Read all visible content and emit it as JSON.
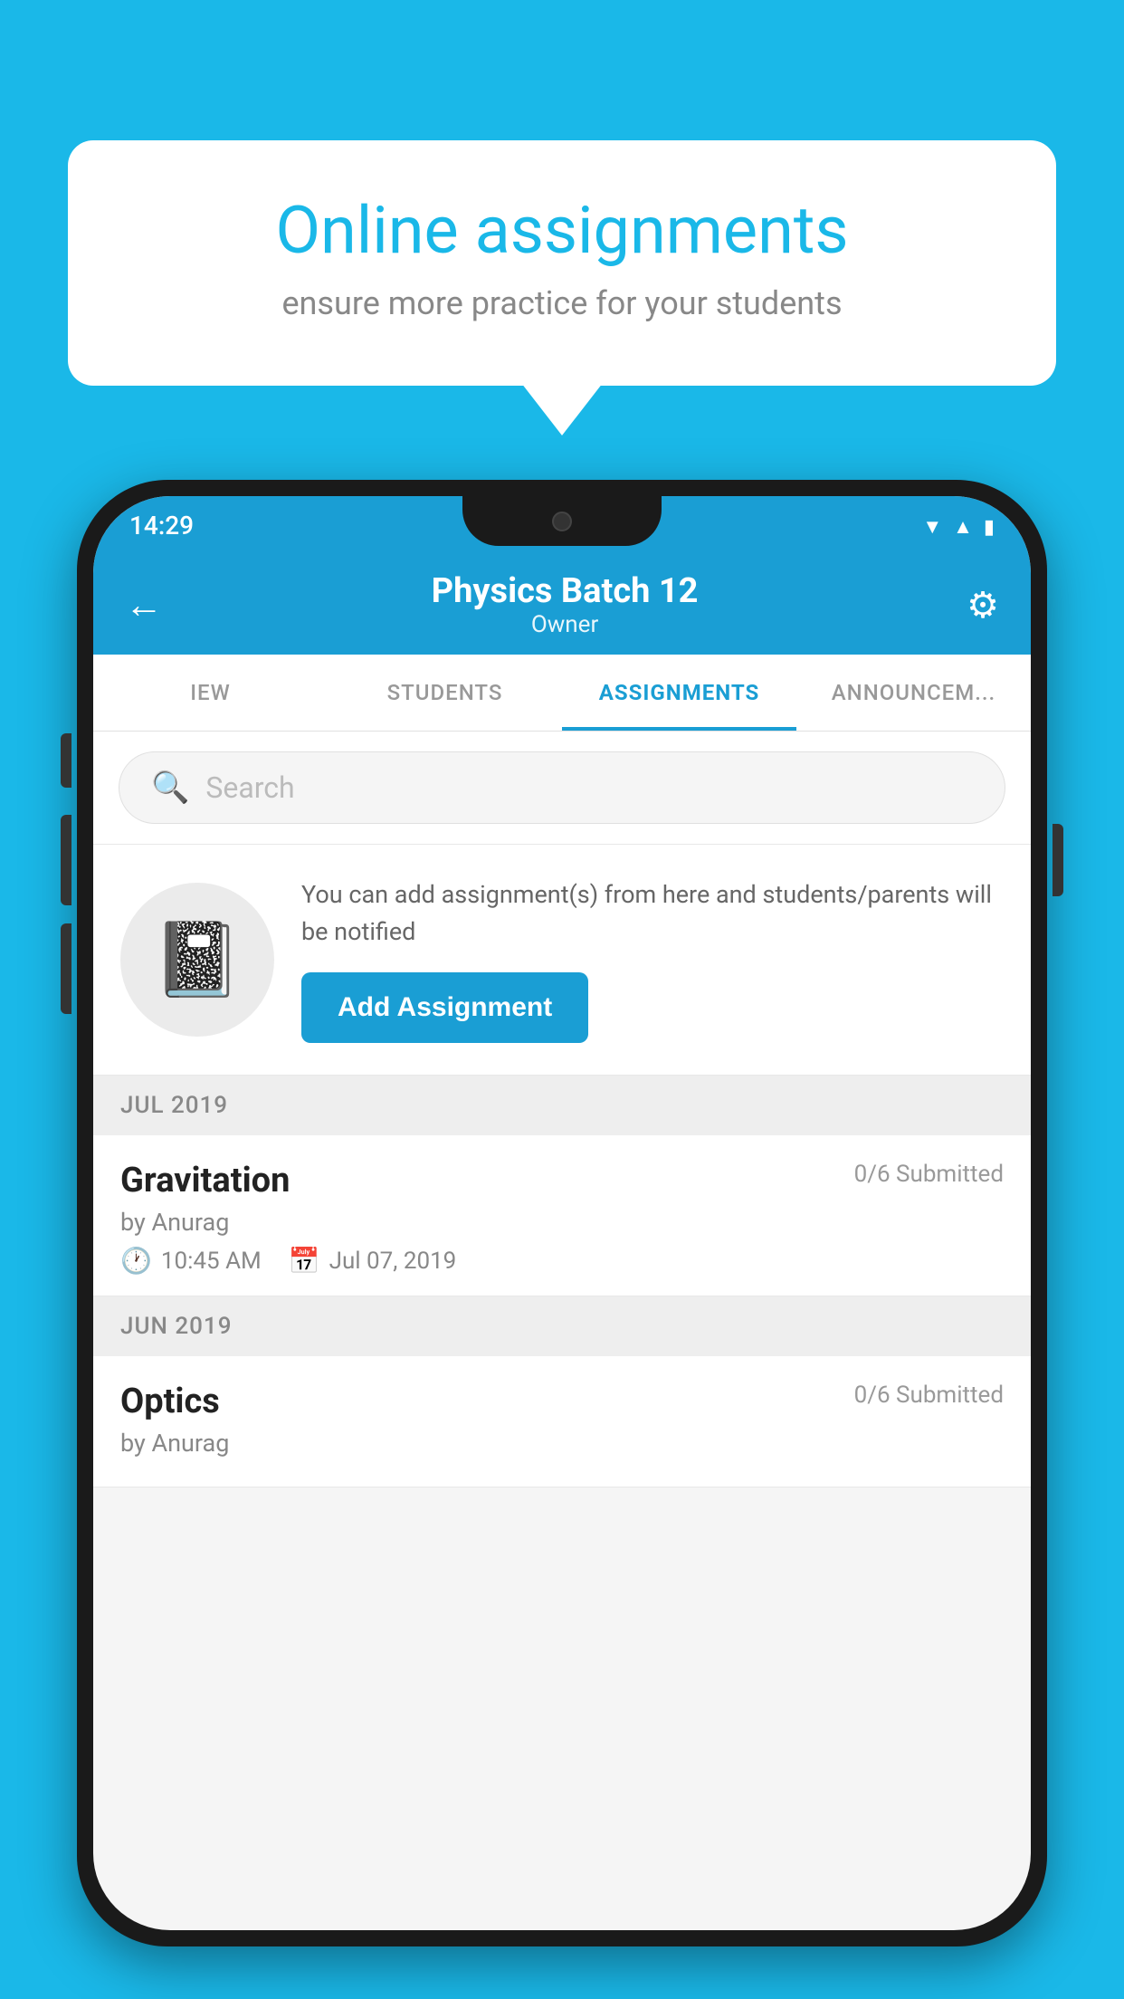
{
  "background_color": "#1ab8e8",
  "speech_bubble": {
    "title": "Online assignments",
    "subtitle": "ensure more practice for your students"
  },
  "phone": {
    "status_bar": {
      "time": "14:29",
      "icons": [
        "wifi",
        "signal",
        "battery"
      ]
    },
    "header": {
      "title": "Physics Batch 12",
      "subtitle": "Owner",
      "back_label": "←",
      "gear_label": "⚙"
    },
    "tabs": [
      {
        "label": "IEW",
        "active": false
      },
      {
        "label": "STUDENTS",
        "active": false
      },
      {
        "label": "ASSIGNMENTS",
        "active": true
      },
      {
        "label": "ANNOUNCEM...",
        "active": false
      }
    ],
    "search": {
      "placeholder": "Search"
    },
    "add_assignment_card": {
      "description": "You can add assignment(s) from here and students/parents will be notified",
      "button_label": "Add Assignment"
    },
    "sections": [
      {
        "header": "JUL 2019",
        "items": [
          {
            "name": "Gravitation",
            "submitted": "0/6 Submitted",
            "author": "by Anurag",
            "time": "10:45 AM",
            "date": "Jul 07, 2019"
          }
        ]
      },
      {
        "header": "JUN 2019",
        "items": [
          {
            "name": "Optics",
            "submitted": "0/6 Submitted",
            "author": "by Anurag",
            "time": "",
            "date": ""
          }
        ]
      }
    ]
  }
}
